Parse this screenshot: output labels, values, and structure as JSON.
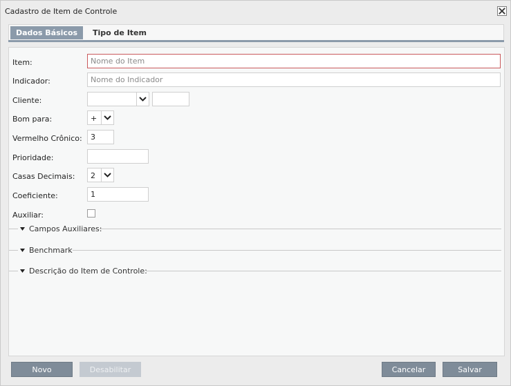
{
  "window": {
    "title": "Cadastro de Item de Controle"
  },
  "tabs": [
    {
      "label": "Dados Básicos",
      "active": true
    },
    {
      "label": "Tipo de Item",
      "active": false
    }
  ],
  "form": {
    "item": {
      "label": "Item:",
      "value": "",
      "placeholder": "Nome do Item"
    },
    "indicador": {
      "label": "Indicador:",
      "value": "",
      "placeholder": "Nome do Indicador"
    },
    "cliente": {
      "label": "Cliente:",
      "value": "",
      "extra_value": ""
    },
    "bom_para": {
      "label": "Bom para:",
      "value": "+"
    },
    "vermelho_cronico": {
      "label": "Vermelho Crônico:",
      "value": "3"
    },
    "prioridade": {
      "label": "Prioridade:",
      "value": ""
    },
    "casas_decimais": {
      "label": "Casas Decimais:",
      "value": "2"
    },
    "coeficiente": {
      "label": "Coeficiente:",
      "value": "1"
    },
    "auxiliar": {
      "label": "Auxiliar:",
      "checked": false
    }
  },
  "sections": [
    {
      "label": "Campos Auxiliares:"
    },
    {
      "label": "Benchmark"
    },
    {
      "label": "Descrição do Item de Controle:"
    }
  ],
  "buttons": {
    "novo": "Novo",
    "desabilitar": "Desabilitar",
    "cancelar": "Cancelar",
    "salvar": "Salvar"
  },
  "colors": {
    "accent": "#8b9aaa",
    "button": "#7f8c99",
    "error_border": "#c9595b"
  }
}
